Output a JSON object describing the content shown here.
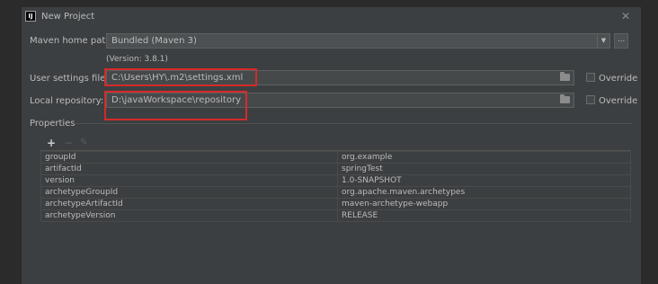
{
  "window": {
    "title": "New Project",
    "icon_text": "IJ"
  },
  "maven": {
    "home_label": "Maven home path:",
    "home_value": "Bundled (Maven 3)",
    "version_text": "(Version: 3.8.1)",
    "browse_label": "..."
  },
  "user_settings": {
    "label": "User settings file:",
    "value": "C:\\Users\\HY\\.m2\\settings.xml",
    "override_label": "Override"
  },
  "local_repo": {
    "label": "Local repository:",
    "value": "D:\\javaWorkspace\\repository",
    "override_label": "Override"
  },
  "properties": {
    "section_label": "Properties",
    "rows": [
      {
        "key": "groupId",
        "value": "org.example"
      },
      {
        "key": "artifactId",
        "value": "springTest"
      },
      {
        "key": "version",
        "value": "1.0-SNAPSHOT"
      },
      {
        "key": "archetypeGroupId",
        "value": "org.apache.maven.archetypes"
      },
      {
        "key": "archetypeArtifactId",
        "value": "maven-archetype-webapp"
      },
      {
        "key": "archetypeVersion",
        "value": "RELEASE"
      }
    ]
  },
  "colors": {
    "dialog_bg": "#3c3f41",
    "highlight_red": "#d42a2a",
    "add_icon": "#b7b7b7"
  },
  "icons": [
    "close-icon",
    "folder-icon",
    "chevron-down-icon",
    "add-icon",
    "remove-icon",
    "edit-icon"
  ]
}
